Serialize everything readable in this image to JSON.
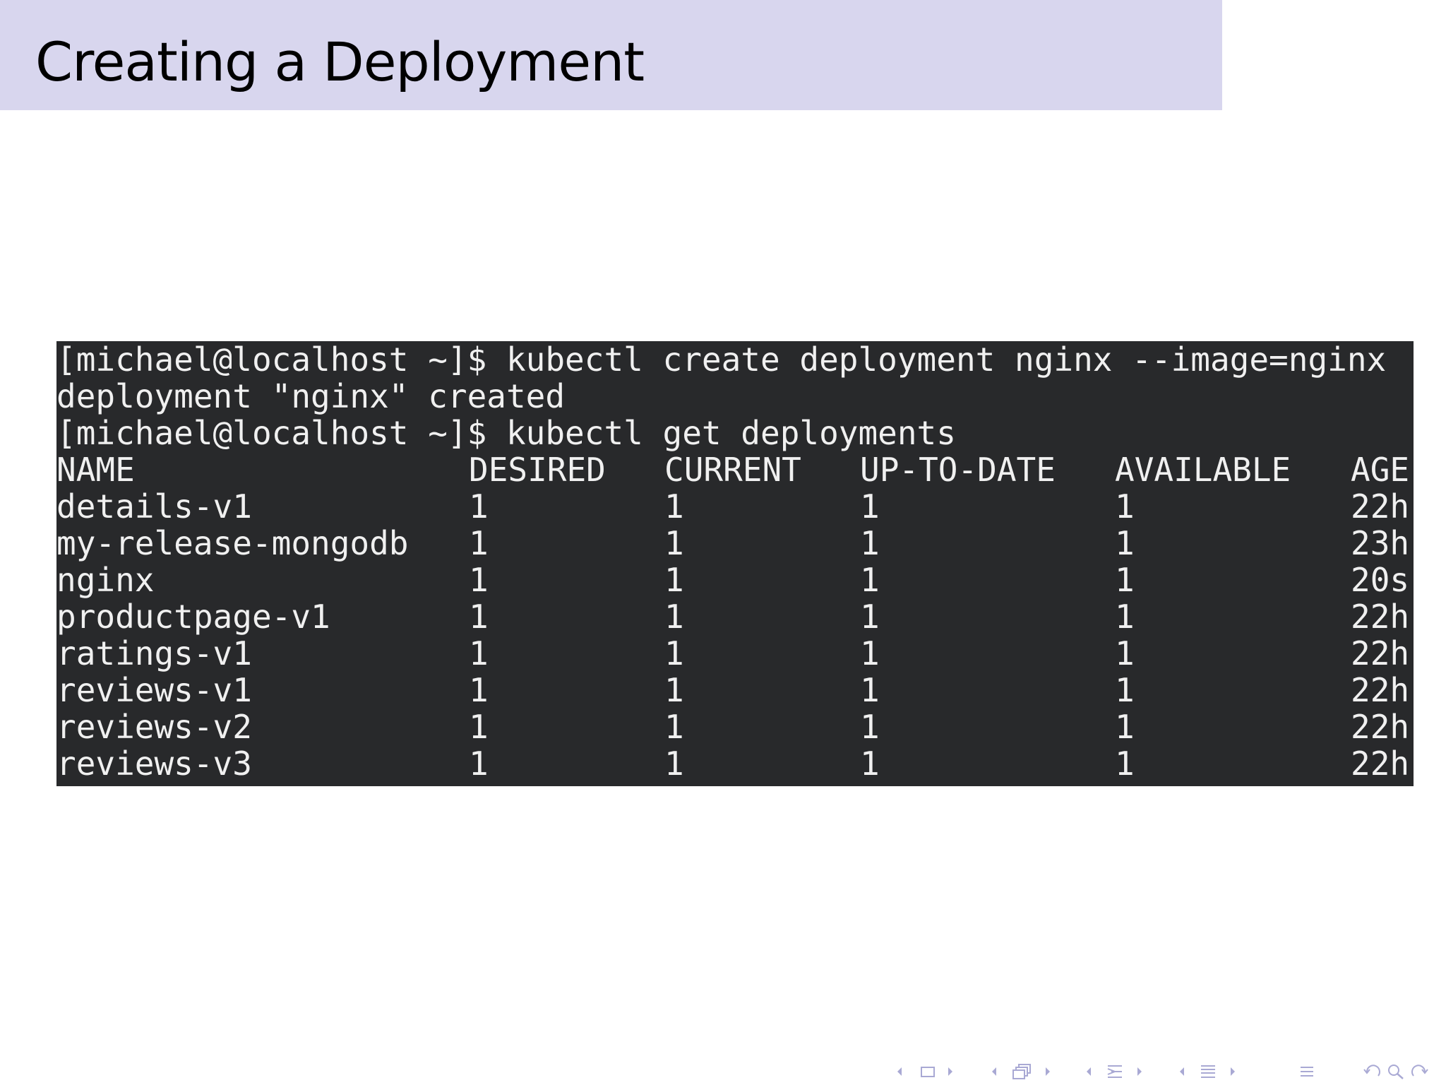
{
  "slide": {
    "title": "Creating a Deployment"
  },
  "terminal": {
    "lines": [
      "[michael@localhost ~]$ kubectl create deployment nginx --image=nginx",
      "deployment \"nginx\" created",
      "[michael@localhost ~]$ kubectl get deployments"
    ],
    "table": {
      "headers": [
        "NAME",
        "DESIRED",
        "CURRENT",
        "UP-TO-DATE",
        "AVAILABLE",
        "AGE"
      ],
      "rows": [
        [
          "details-v1",
          "1",
          "1",
          "1",
          "1",
          "22h"
        ],
        [
          "my-release-mongodb",
          "1",
          "1",
          "1",
          "1",
          "23h"
        ],
        [
          "nginx",
          "1",
          "1",
          "1",
          "1",
          "20s"
        ],
        [
          "productpage-v1",
          "1",
          "1",
          "1",
          "1",
          "22h"
        ],
        [
          "ratings-v1",
          "1",
          "1",
          "1",
          "1",
          "22h"
        ],
        [
          "reviews-v1",
          "1",
          "1",
          "1",
          "1",
          "22h"
        ],
        [
          "reviews-v2",
          "1",
          "1",
          "1",
          "1",
          "22h"
        ],
        [
          "reviews-v3",
          "1",
          "1",
          "1",
          "1",
          "22h"
        ]
      ]
    }
  },
  "navigation": {
    "icons": [
      "arrow-left-icon",
      "frame-icon",
      "arrow-right-icon",
      "arrow-left-icon",
      "subsection-icon",
      "arrow-right-icon",
      "arrow-left-icon",
      "section-icon",
      "arrow-right-icon",
      "arrow-left-icon",
      "section-icon",
      "arrow-right-icon",
      "appendix-icon",
      "back-icon",
      "search-icon",
      "forward-icon"
    ],
    "color": "#a9a9d4"
  },
  "colors": {
    "title_band": "#d8d6ee",
    "terminal_background": "#28292b",
    "terminal_text": "#f0f0f0"
  }
}
